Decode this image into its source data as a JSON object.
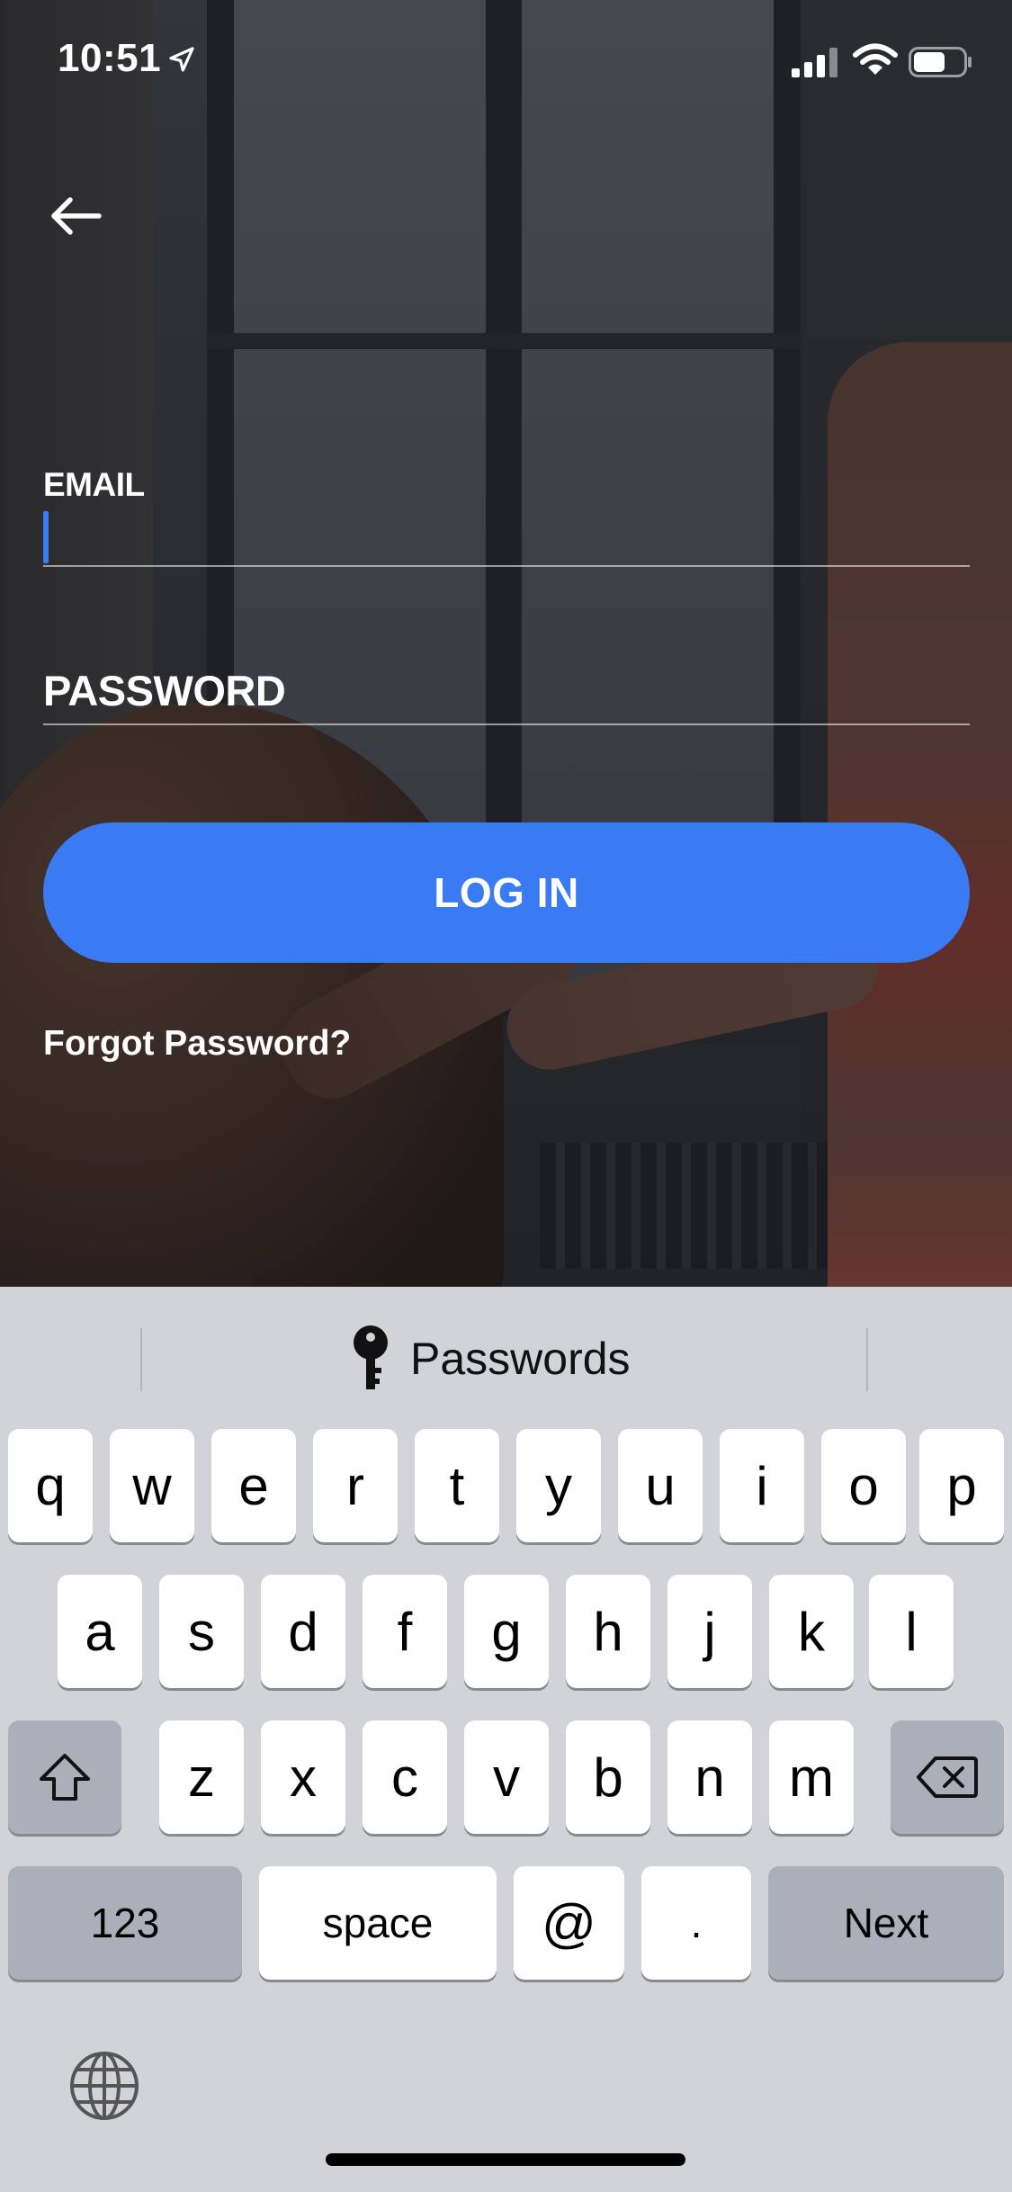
{
  "status_bar": {
    "time": "10:51",
    "icons": [
      "location-arrow-icon",
      "cellular-signal-icon",
      "wifi-icon",
      "battery-icon"
    ]
  },
  "nav": {
    "back_icon": "arrow-left-icon"
  },
  "form": {
    "email_label": "EMAIL",
    "email_value": "",
    "password_label": "PASSWORD",
    "password_value": "",
    "login_label": "LOG IN",
    "forgot_label": "Forgot Password?"
  },
  "keyboard": {
    "suggestion": "Passwords",
    "suggestion_icon": "key-icon",
    "row1": [
      "q",
      "w",
      "e",
      "r",
      "t",
      "y",
      "u",
      "i",
      "o",
      "p"
    ],
    "row2": [
      "a",
      "s",
      "d",
      "f",
      "g",
      "h",
      "j",
      "k",
      "l"
    ],
    "row3": [
      "z",
      "x",
      "c",
      "v",
      "b",
      "n",
      "m"
    ],
    "numbers_label": "123",
    "space_label": "space",
    "at_label": "@",
    "dot_label": ".",
    "next_label": "Next",
    "shift_icon": "shift-icon",
    "delete_icon": "delete-icon",
    "globe_icon": "globe-icon"
  },
  "colors": {
    "accent": "#3a7bf4",
    "keyboard_bg": "#d1d3d9",
    "key_dark": "#abafb9"
  }
}
